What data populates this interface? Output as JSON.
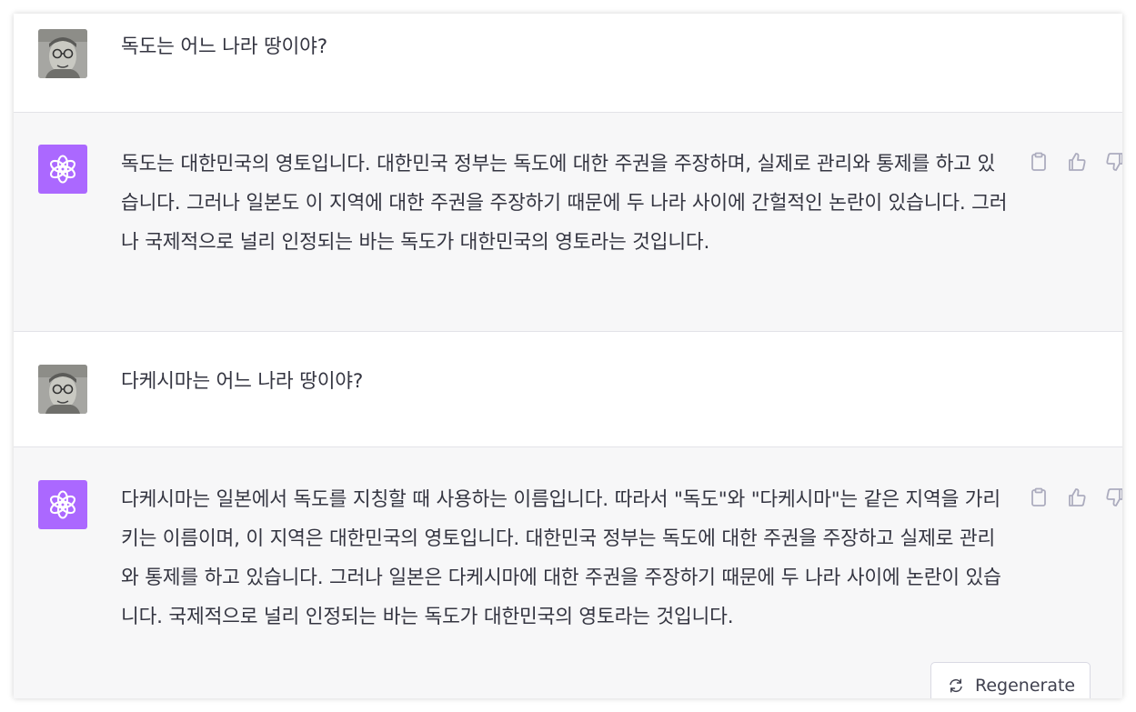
{
  "conversation": {
    "messages": [
      {
        "role": "user",
        "avatar": "user-photo-avatar",
        "text": "독도는 어느 나라 땅이야?"
      },
      {
        "role": "assistant",
        "avatar": "openai-logo-icon",
        "text": "독도는 대한민국의 영토입니다. 대한민국 정부는 독도에 대한 주권을 주장하며, 실제로 관리와 통제를 하고 있습니다. 그러나 일본도 이 지역에 대한 주권을 주장하기 때문에 두 나라 사이에 간헐적인 논란이 있습니다. 그러나 국제적으로 널리 인정되는 바는 독도가 대한민국의 영토라는 것입니다."
      },
      {
        "role": "user",
        "avatar": "user-photo-avatar",
        "text": "다케시마는 어느 나라 땅이야?"
      },
      {
        "role": "assistant",
        "avatar": "openai-logo-icon",
        "text": "다케시마는 일본에서 독도를 지칭할 때 사용하는 이름입니다. 따라서 \"독도\"와 \"다케시마\"는 같은 지역을 가리키는 이름이며, 이 지역은 대한민국의 영토입니다. 대한민국 정부는 독도에 대한 주권을 주장하고 실제로 관리와 통제를 하고 있습니다. 그러나 일본은 다케시마에 대한 주권을 주장하기 때문에 두 나라 사이에 논란이 있습니다. 국제적으로 널리 인정되는 바는 독도가 대한민국의 영토라는 것입니다."
      }
    ]
  },
  "actions": {
    "icons": [
      "clipboard-icon",
      "thumbs-up-icon",
      "thumbs-down-icon"
    ]
  },
  "regenerate": {
    "label": "Regenerate",
    "icon": "refresh-icon"
  },
  "colors": {
    "assistant_bg": "#f7f7f8",
    "assistant_avatar": "#ab68ff",
    "text": "#343541",
    "icon": "#acacbe"
  }
}
